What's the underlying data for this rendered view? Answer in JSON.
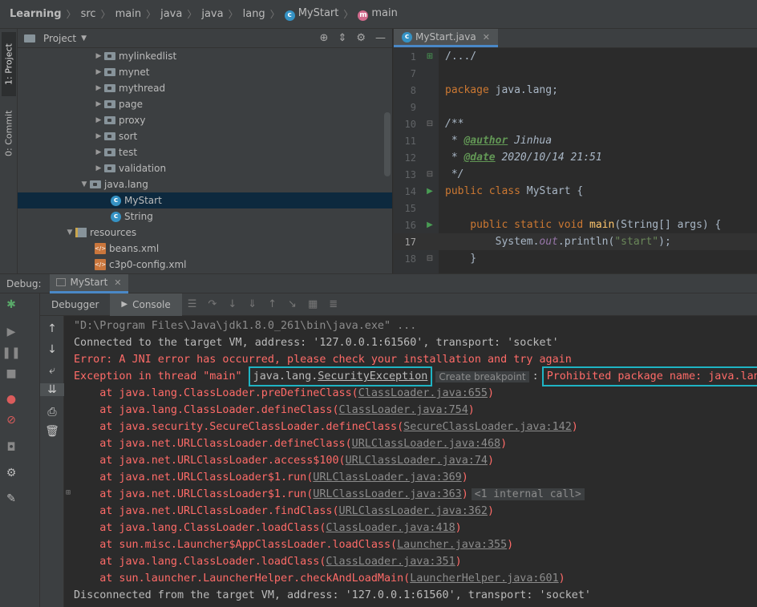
{
  "breadcrumb": {
    "items": [
      "Learning",
      "src",
      "main",
      "java",
      "java",
      "lang"
    ],
    "class_name": "MyStart",
    "method_name": "main"
  },
  "left_strip": {
    "project_tab": "1: Project",
    "commit_tab": "0: Commit"
  },
  "project_panel": {
    "title": "Project",
    "tree": [
      {
        "label": "mylinkedlist",
        "type": "package"
      },
      {
        "label": "mynet",
        "type": "package"
      },
      {
        "label": "mythread",
        "type": "package"
      },
      {
        "label": "page",
        "type": "package"
      },
      {
        "label": "proxy",
        "type": "package"
      },
      {
        "label": "sort",
        "type": "package"
      },
      {
        "label": "test",
        "type": "package"
      },
      {
        "label": "validation",
        "type": "package"
      },
      {
        "label": "java.lang",
        "type": "package"
      },
      {
        "label": "MyStart",
        "type": "class"
      },
      {
        "label": "String",
        "type": "class"
      },
      {
        "label": "resources",
        "type": "resources"
      },
      {
        "label": "beans.xml",
        "type": "xml"
      },
      {
        "label": "c3p0-config.xml",
        "type": "xml"
      }
    ]
  },
  "editor": {
    "tab_label": "MyStart.java",
    "line_numbers": [
      "1",
      "7",
      "8",
      "9",
      "10",
      "11",
      "12",
      "13",
      "14",
      "15",
      "16",
      "17",
      "18"
    ],
    "lines": {
      "l1": "/.../",
      "l8_kw": "package",
      "l8_rest": " java.lang;",
      "l10": "/**",
      "l11_pre": " * ",
      "l11_tag": "@author",
      "l11_rest": " Jinhua",
      "l12_pre": " * ",
      "l12_tag": "@date",
      "l12_rest": " 2020/10/14 21:51",
      "l13": " */",
      "l14_kw": "public class",
      "l14_rest": " MyStart {",
      "l16_kw": "    public static void",
      "l16_fn": " main",
      "l16_rest": "(String[] args) {",
      "l17_pre": "        System.",
      "l17_fld": "out",
      "l17_mid": ".println(",
      "l17_str": "\"start\"",
      "l17_end": ");",
      "l18": "    }"
    }
  },
  "debug": {
    "label": "Debug:",
    "tab_label": "MyStart",
    "debugger_tab": "Debugger",
    "console_tab": "Console"
  },
  "console": {
    "l0": "\"D:\\Program Files\\Java\\jdk1.8.0_261\\bin\\java.exe\" ...",
    "l1": "Connected to the target VM, address: '127.0.0.1:61560', transport: 'socket'",
    "l2": "Error: A JNI error has occurred, please check your installation and try again",
    "l3_pre": "Exception in thread \"main\" ",
    "l3_pkg": "java.lang.",
    "l3_exc": "SecurityException",
    "l3_pill": "Create breakpoint",
    "l3_colon": ":",
    "l3_msg": "Prohibited package name: java.lang",
    "trace": [
      {
        "pre": "    at java.lang.ClassLoader.preDefineClass(",
        "link": "ClassLoader.java:655",
        "post": ")"
      },
      {
        "pre": "    at java.lang.ClassLoader.defineClass(",
        "link": "ClassLoader.java:754",
        "post": ")"
      },
      {
        "pre": "    at java.security.SecureClassLoader.defineClass(",
        "link": "SecureClassLoader.java:142",
        "post": ")"
      },
      {
        "pre": "    at java.net.URLClassLoader.defineClass(",
        "link": "URLClassLoader.java:468",
        "post": ")"
      },
      {
        "pre": "    at java.net.URLClassLoader.access$100(",
        "link": "URLClassLoader.java:74",
        "post": ")"
      },
      {
        "pre": "    at java.net.URLClassLoader$1.run(",
        "link": "URLClassLoader.java:369",
        "post": ")"
      },
      {
        "pre": "    at java.net.URLClassLoader$1.run(",
        "link": "URLClassLoader.java:363",
        "post": ")",
        "pill": "<1 internal call>"
      },
      {
        "pre": "    at java.net.URLClassLoader.findClass(",
        "link": "URLClassLoader.java:362",
        "post": ")"
      },
      {
        "pre": "    at java.lang.ClassLoader.loadClass(",
        "link": "ClassLoader.java:418",
        "post": ")"
      },
      {
        "pre": "    at sun.misc.Launcher$AppClassLoader.loadClass(",
        "link": "Launcher.java:355",
        "post": ")"
      },
      {
        "pre": "    at java.lang.ClassLoader.loadClass(",
        "link": "ClassLoader.java:351",
        "post": ")"
      },
      {
        "pre": "    at sun.launcher.LauncherHelper.checkAndLoadMain(",
        "link": "LauncherHelper.java:601",
        "post": ")"
      }
    ],
    "last": "Disconnected from the target VM, address: '127.0.0.1:61560', transport: 'socket'"
  },
  "colors": {
    "error_red": "#ff6b68",
    "highlight_box": "#1fb4c4",
    "selection": "#0d293e"
  }
}
